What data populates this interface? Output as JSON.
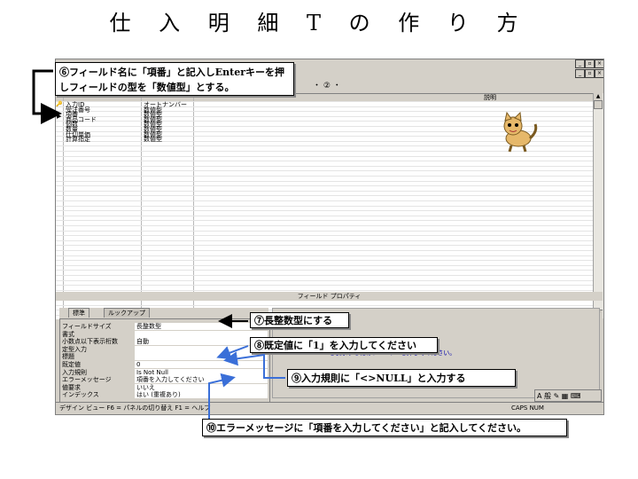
{
  "title": "仕 入 明 細 T の 作 り 方",
  "window": {
    "toolbar_fragment": "・ ② ・",
    "grid_header_description": "説明",
    "fields": [
      {
        "name": "入力ID",
        "type": "オートナンバー"
      },
      {
        "name": "受注番号",
        "type": "数値型"
      },
      {
        "name": "項番",
        "type": "数値型"
      },
      {
        "name": "商品コード",
        "type": "数値型"
      },
      {
        "name": "個数",
        "type": "数値型"
      },
      {
        "name": "数量",
        "type": "数値型"
      },
      {
        "name": "仕切単価",
        "type": "数値型"
      },
      {
        "name": "計算指定",
        "type": "数値型"
      }
    ],
    "field_properties_label": "フィールド プロパティ",
    "tabs": [
      "標準",
      "ルックアップ"
    ],
    "properties": [
      {
        "label": "フィールドサイズ",
        "value": "長整数型"
      },
      {
        "label": "書式",
        "value": ""
      },
      {
        "label": "小数点以下表示桁数",
        "value": "自動"
      },
      {
        "label": "定型入力",
        "value": ""
      },
      {
        "label": "標題",
        "value": ""
      },
      {
        "label": "既定値",
        "value": "0"
      },
      {
        "label": "入力規則",
        "value": "Is Not Null"
      },
      {
        "label": "エラーメッセージ",
        "value": "項番を入力してください"
      },
      {
        "label": "値要求",
        "value": "いいえ"
      },
      {
        "label": "インデックス",
        "value": "はい (重複あり)"
      }
    ],
    "help_text": "を表示するには、F1 キーを押してください。",
    "statusbar": "デザイン ビュー   F6 = パネルの切り替え   F1 = ヘルプ",
    "status_right": "CAPS   NUM",
    "tray": "A 般"
  },
  "callouts": {
    "c6": "⑥フィールド名に「項番」と記入しEnterキーを押しフィールドの型を「数値型」とする。",
    "c7": "⑦長整数型にする",
    "c8": "⑧既定値に「1」を入力してください",
    "c9": "⑨入力規則に「<>NULL」と入力する",
    "c10": "⑩エラーメッセージに「項番を入力してください」と記入してください。"
  },
  "colors": {
    "callout_border": "#000000",
    "arrow_black": "#000000",
    "arrow_blue": "#3a6fd8",
    "window_gray": "#d4d0c8"
  }
}
